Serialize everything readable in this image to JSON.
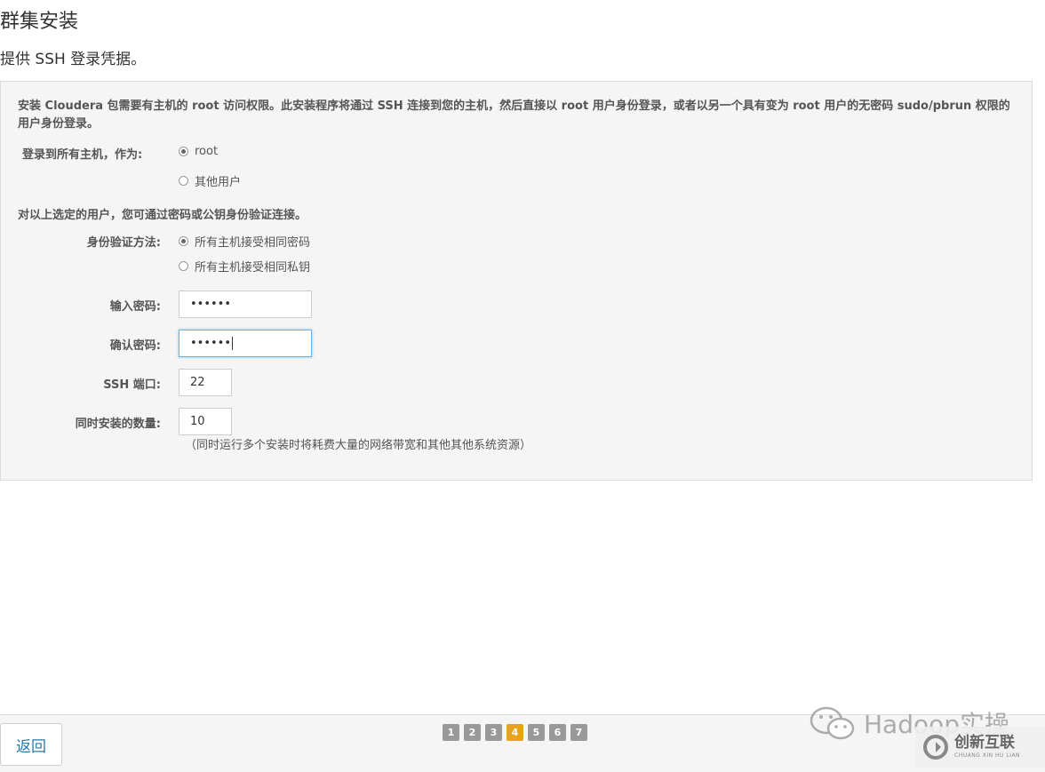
{
  "page": {
    "title": "群集安装",
    "subtitle": "提供 SSH 登录凭据。"
  },
  "panel": {
    "intro": "安装 Cloudera 包需要有主机的 root 访问权限。此安装程序将通过 SSH 连接到您的主机，然后直接以 root 用户身份登录，或者以另一个具有变为 root 用户的无密码 sudo/pbrun 权限的用户身份登录。",
    "login_label": "登录到所有主机，作为:",
    "login_options": [
      {
        "label": "root",
        "checked": true
      },
      {
        "label": "其他用户",
        "checked": false
      }
    ],
    "auth_note": "对以上选定的用户，您可通过密码或公钥身份验证连接。",
    "auth_label": "身份验证方法:",
    "auth_options": [
      {
        "label": "所有主机接受相同密码",
        "checked": true
      },
      {
        "label": "所有主机接受相同私钥",
        "checked": false
      }
    ],
    "password_label": "输入密码:",
    "password_value": "••••••",
    "confirm_label": "确认密码:",
    "confirm_value": "••••••",
    "ssh_port_label": "SSH 端口:",
    "ssh_port_value": "22",
    "concurrent_label": "同时安装的数量:",
    "concurrent_value": "10",
    "concurrent_hint": "（同时运行多个安装时将耗费大量的网络带宽和其他其他系统资源）"
  },
  "footer": {
    "back_label": "返回",
    "steps": [
      "1",
      "2",
      "3",
      "4",
      "5",
      "6",
      "7"
    ],
    "active_step": 4,
    "active_color": "#e8a21b",
    "inactive_color": "#999999"
  },
  "watermark": {
    "text": "Hadoop实操",
    "brand_cn": "创新互联",
    "brand_en": "CHUANG XIN HU LIAN"
  }
}
